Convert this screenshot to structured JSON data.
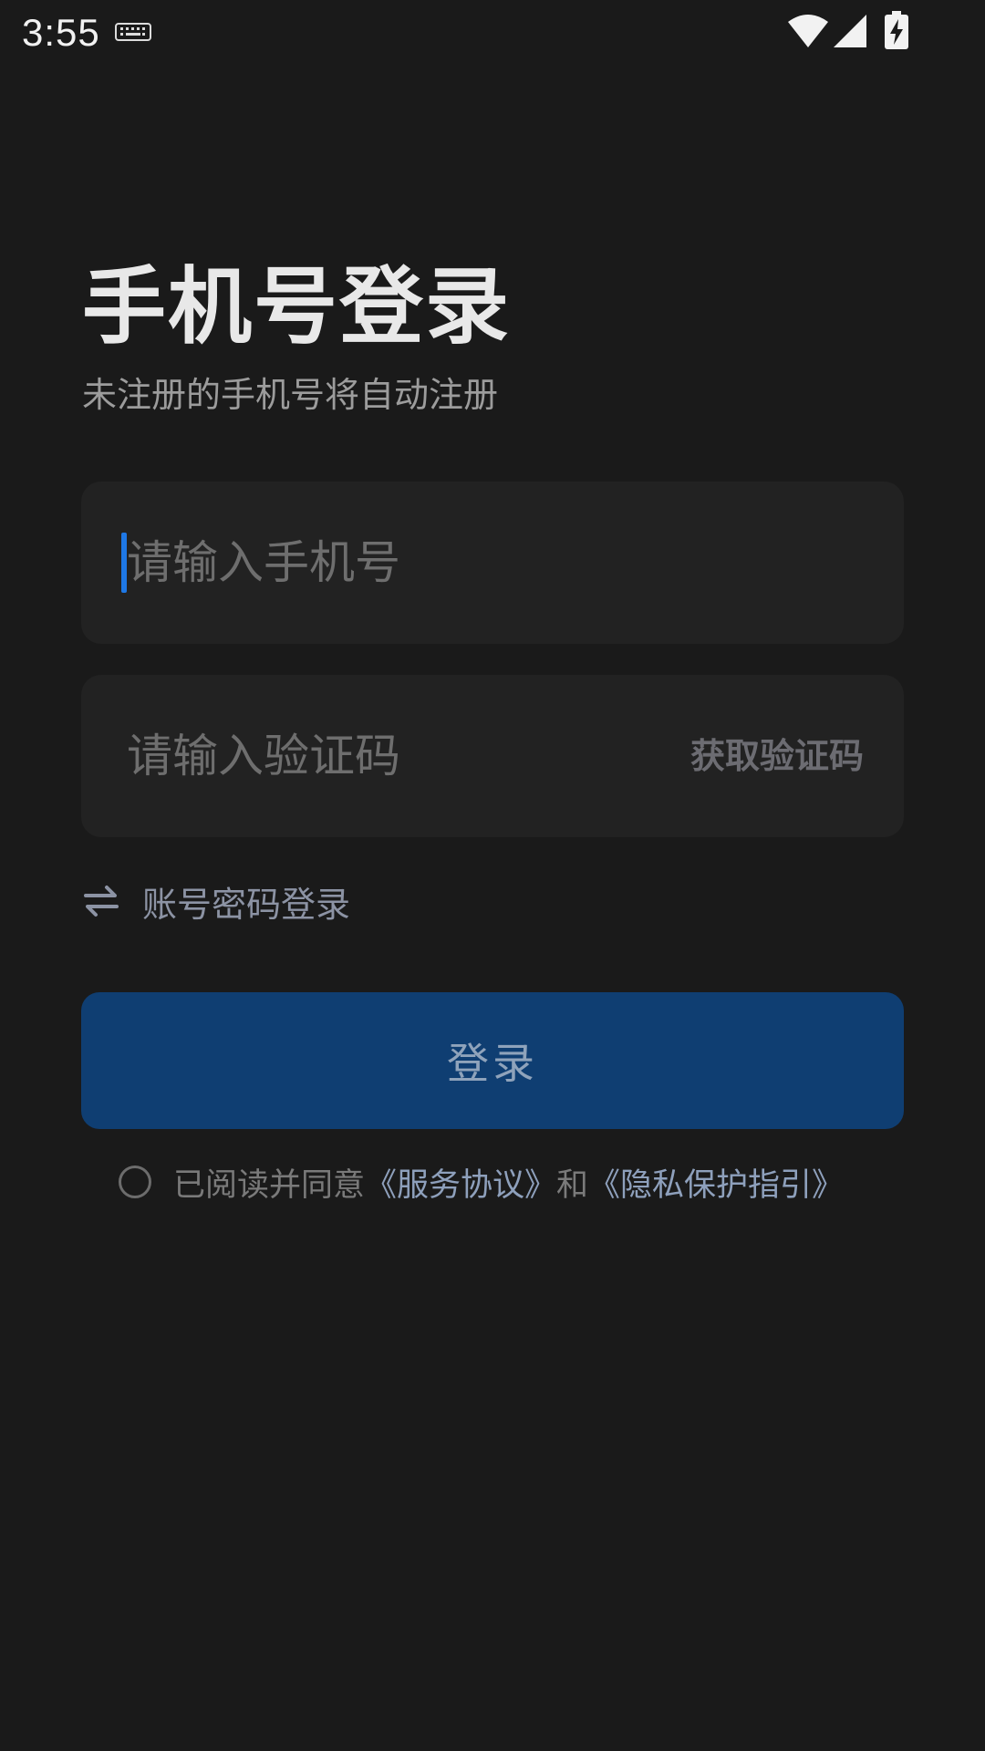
{
  "status_bar": {
    "time": "3:55",
    "icons": [
      "keyboard-icon",
      "wifi-icon",
      "signal-icon",
      "battery-charging-icon"
    ]
  },
  "login": {
    "title": "手机号登录",
    "subtitle": "未注册的手机号将自动注册",
    "phone_placeholder": "请输入手机号",
    "code_placeholder": "请输入验证码",
    "get_code_label": "获取验证码",
    "switch_label": "账号密码登录",
    "switch_icon": "swap-arrows-icon",
    "submit_label": "登录"
  },
  "agreement": {
    "prefix": "已阅读并同意",
    "service_link": "《服务协议》",
    "and": "和",
    "privacy_link": "《隐私保护指引》",
    "checked": false
  },
  "colors": {
    "background": "#1a1a1a",
    "field": "#222222",
    "primary_button": "#0f3e72",
    "caret": "#1e78e6",
    "link": "#8ea0bc"
  }
}
